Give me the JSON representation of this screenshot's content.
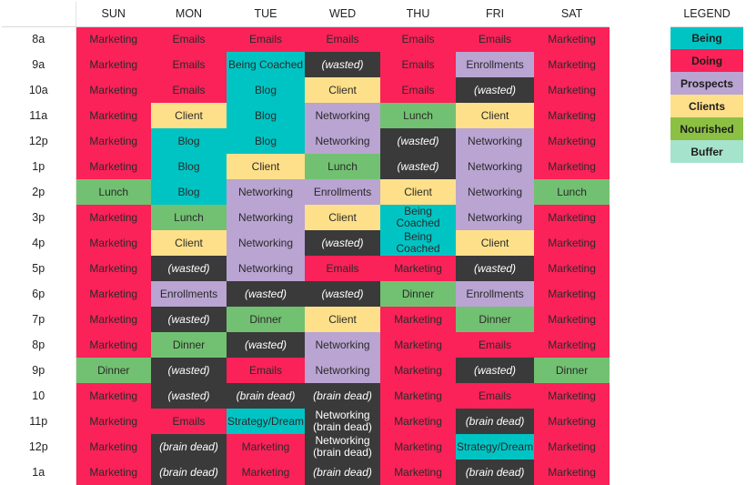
{
  "header": {
    "row_label_header": "",
    "days": [
      "SUN",
      "MON",
      "TUE",
      "WED",
      "THU",
      "FRI",
      "SAT"
    ],
    "legend_title": "LEGEND"
  },
  "legend": {
    "items": [
      {
        "label": "Being",
        "color": "#00c4c4"
      },
      {
        "label": "Doing",
        "color": "#fa2258"
      },
      {
        "label": "Prospects",
        "color": "#b9a4d2"
      },
      {
        "label": "Clients",
        "color": "#ffe08a"
      },
      {
        "label": "Nourished",
        "color": "#8cc043"
      },
      {
        "label": "Buffer",
        "color": "#a6e3cd"
      }
    ]
  },
  "categories": {
    "being": "#00c4c4",
    "doing": "#fa2258",
    "prospects": "#b9a4d2",
    "clients": "#ffe08a",
    "nourished": "#72c172",
    "buffer": "#a6e3cd",
    "dark": "#3a3a3a"
  },
  "schedule": {
    "hours": [
      "8a",
      "9a",
      "10a",
      "11a",
      "12p",
      "1p",
      "2p",
      "3p",
      "4p",
      "5p",
      "6p",
      "7p",
      "8p",
      "9p",
      "10",
      "11p",
      "12p",
      "1a"
    ],
    "rows": [
      {
        "hour": "8a",
        "cells": [
          {
            "text": "Marketing",
            "cat": "doing"
          },
          {
            "text": "Emails",
            "cat": "doing"
          },
          {
            "text": "Emails",
            "cat": "doing"
          },
          {
            "text": "Emails",
            "cat": "doing"
          },
          {
            "text": "Emails",
            "cat": "doing"
          },
          {
            "text": "Emails",
            "cat": "doing"
          },
          {
            "text": "Marketing",
            "cat": "doing"
          }
        ]
      },
      {
        "hour": "9a",
        "cells": [
          {
            "text": "Marketing",
            "cat": "doing"
          },
          {
            "text": "Emails",
            "cat": "doing"
          },
          {
            "text": "Being Coached",
            "cat": "being"
          },
          {
            "text": "(wasted)",
            "cat": "dark"
          },
          {
            "text": "Emails",
            "cat": "doing"
          },
          {
            "text": "Enrollments",
            "cat": "prospects"
          },
          {
            "text": "Marketing",
            "cat": "doing"
          }
        ]
      },
      {
        "hour": "10a",
        "cells": [
          {
            "text": "Marketing",
            "cat": "doing"
          },
          {
            "text": "Emails",
            "cat": "doing"
          },
          {
            "text": "Blog",
            "cat": "being"
          },
          {
            "text": "Client",
            "cat": "clients"
          },
          {
            "text": "Emails",
            "cat": "doing"
          },
          {
            "text": "(wasted)",
            "cat": "dark"
          },
          {
            "text": "Marketing",
            "cat": "doing"
          }
        ]
      },
      {
        "hour": "11a",
        "cells": [
          {
            "text": "Marketing",
            "cat": "doing"
          },
          {
            "text": "Client",
            "cat": "clients"
          },
          {
            "text": "Blog",
            "cat": "being"
          },
          {
            "text": "Networking",
            "cat": "prospects"
          },
          {
            "text": "Lunch",
            "cat": "nourished"
          },
          {
            "text": "Client",
            "cat": "clients"
          },
          {
            "text": "Marketing",
            "cat": "doing"
          }
        ]
      },
      {
        "hour": "12p",
        "cells": [
          {
            "text": "Marketing",
            "cat": "doing"
          },
          {
            "text": "Blog",
            "cat": "being"
          },
          {
            "text": "Blog",
            "cat": "being"
          },
          {
            "text": "Networking",
            "cat": "prospects"
          },
          {
            "text": "(wasted)",
            "cat": "dark"
          },
          {
            "text": "Networking",
            "cat": "prospects"
          },
          {
            "text": "Marketing",
            "cat": "doing"
          }
        ]
      },
      {
        "hour": "1p",
        "cells": [
          {
            "text": "Marketing",
            "cat": "doing"
          },
          {
            "text": "Blog",
            "cat": "being"
          },
          {
            "text": "Client",
            "cat": "clients"
          },
          {
            "text": "Lunch",
            "cat": "nourished"
          },
          {
            "text": "(wasted)",
            "cat": "dark"
          },
          {
            "text": "Networking",
            "cat": "prospects"
          },
          {
            "text": "Marketing",
            "cat": "doing"
          }
        ]
      },
      {
        "hour": "2p",
        "cells": [
          {
            "text": "Lunch",
            "cat": "nourished"
          },
          {
            "text": "Blog",
            "cat": "being"
          },
          {
            "text": "Networking",
            "cat": "prospects"
          },
          {
            "text": "Enrollments",
            "cat": "prospects"
          },
          {
            "text": "Client",
            "cat": "clients"
          },
          {
            "text": "Networking",
            "cat": "prospects"
          },
          {
            "text": "Lunch",
            "cat": "nourished"
          }
        ]
      },
      {
        "hour": "3p",
        "cells": [
          {
            "text": "Marketing",
            "cat": "doing"
          },
          {
            "text": "Lunch",
            "cat": "nourished"
          },
          {
            "text": "Networking",
            "cat": "prospects"
          },
          {
            "text": "Client",
            "cat": "clients"
          },
          {
            "text": "Being Coached",
            "cat": "being"
          },
          {
            "text": "Networking",
            "cat": "prospects"
          },
          {
            "text": "Marketing",
            "cat": "doing"
          }
        ]
      },
      {
        "hour": "4p",
        "cells": [
          {
            "text": "Marketing",
            "cat": "doing"
          },
          {
            "text": "Client",
            "cat": "clients"
          },
          {
            "text": "Networking",
            "cat": "prospects"
          },
          {
            "text": "(wasted)",
            "cat": "dark"
          },
          {
            "text": "Being Coached",
            "cat": "being"
          },
          {
            "text": "Client",
            "cat": "clients"
          },
          {
            "text": "Marketing",
            "cat": "doing"
          }
        ]
      },
      {
        "hour": "5p",
        "cells": [
          {
            "text": "Marketing",
            "cat": "doing"
          },
          {
            "text": "(wasted)",
            "cat": "dark"
          },
          {
            "text": "Networking",
            "cat": "prospects"
          },
          {
            "text": "Emails",
            "cat": "doing"
          },
          {
            "text": "Marketing",
            "cat": "doing"
          },
          {
            "text": "(wasted)",
            "cat": "dark"
          },
          {
            "text": "Marketing",
            "cat": "doing"
          }
        ]
      },
      {
        "hour": "6p",
        "cells": [
          {
            "text": "Marketing",
            "cat": "doing"
          },
          {
            "text": "Enrollments",
            "cat": "prospects"
          },
          {
            "text": "(wasted)",
            "cat": "dark"
          },
          {
            "text": "(wasted)",
            "cat": "dark"
          },
          {
            "text": "Dinner",
            "cat": "nourished"
          },
          {
            "text": "Enrollments",
            "cat": "prospects"
          },
          {
            "text": "Marketing",
            "cat": "doing"
          }
        ]
      },
      {
        "hour": "7p",
        "cells": [
          {
            "text": "Marketing",
            "cat": "doing"
          },
          {
            "text": "(wasted)",
            "cat": "dark"
          },
          {
            "text": "Dinner",
            "cat": "nourished"
          },
          {
            "text": "Client",
            "cat": "clients"
          },
          {
            "text": "Marketing",
            "cat": "doing"
          },
          {
            "text": "Dinner",
            "cat": "nourished"
          },
          {
            "text": "Marketing",
            "cat": "doing"
          }
        ]
      },
      {
        "hour": "8p",
        "cells": [
          {
            "text": "Marketing",
            "cat": "doing"
          },
          {
            "text": "Dinner",
            "cat": "nourished"
          },
          {
            "text": "(wasted)",
            "cat": "dark"
          },
          {
            "text": "Networking",
            "cat": "prospects"
          },
          {
            "text": "Marketing",
            "cat": "doing"
          },
          {
            "text": "Emails",
            "cat": "doing"
          },
          {
            "text": "Marketing",
            "cat": "doing"
          }
        ]
      },
      {
        "hour": "9p",
        "cells": [
          {
            "text": "Dinner",
            "cat": "nourished"
          },
          {
            "text": "(wasted)",
            "cat": "dark"
          },
          {
            "text": "Emails",
            "cat": "doing"
          },
          {
            "text": "Networking",
            "cat": "prospects"
          },
          {
            "text": "Marketing",
            "cat": "doing"
          },
          {
            "text": "(wasted)",
            "cat": "dark"
          },
          {
            "text": "Dinner",
            "cat": "nourished"
          }
        ]
      },
      {
        "hour": "10",
        "cells": [
          {
            "text": "Marketing",
            "cat": "doing"
          },
          {
            "text": "(wasted)",
            "cat": "dark"
          },
          {
            "text": "(brain dead)",
            "cat": "dark"
          },
          {
            "text": "(brain dead)",
            "cat": "dark"
          },
          {
            "text": "Marketing",
            "cat": "doing"
          },
          {
            "text": "Emails",
            "cat": "doing"
          },
          {
            "text": "Marketing",
            "cat": "doing"
          }
        ]
      },
      {
        "hour": "11p",
        "cells": [
          {
            "text": "Marketing",
            "cat": "doing"
          },
          {
            "text": "Emails",
            "cat": "doing"
          },
          {
            "text": "Strategy/Dream",
            "cat": "being"
          },
          {
            "line1": "Networking",
            "line2": "(brain dead)",
            "cat": "dark"
          },
          {
            "text": "Marketing",
            "cat": "doing"
          },
          {
            "text": "(brain dead)",
            "cat": "dark"
          },
          {
            "text": "Marketing",
            "cat": "doing"
          }
        ]
      },
      {
        "hour": "12p",
        "cells": [
          {
            "text": "Marketing",
            "cat": "doing"
          },
          {
            "text": "(brain dead)",
            "cat": "dark"
          },
          {
            "text": "Marketing",
            "cat": "doing"
          },
          {
            "line1": "Networking",
            "line2": "(brain dead)",
            "cat": "dark"
          },
          {
            "text": "Marketing",
            "cat": "doing"
          },
          {
            "text": "Strategy/Dream",
            "cat": "being"
          },
          {
            "text": "Marketing",
            "cat": "doing"
          }
        ]
      },
      {
        "hour": "1a",
        "cells": [
          {
            "text": "Marketing",
            "cat": "doing"
          },
          {
            "text": "(brain dead)",
            "cat": "dark"
          },
          {
            "text": "Marketing",
            "cat": "doing"
          },
          {
            "text": "(brain dead)",
            "cat": "dark"
          },
          {
            "text": "Marketing",
            "cat": "doing"
          },
          {
            "text": "(brain dead)",
            "cat": "dark"
          },
          {
            "text": "Marketing",
            "cat": "doing"
          }
        ]
      }
    ]
  }
}
